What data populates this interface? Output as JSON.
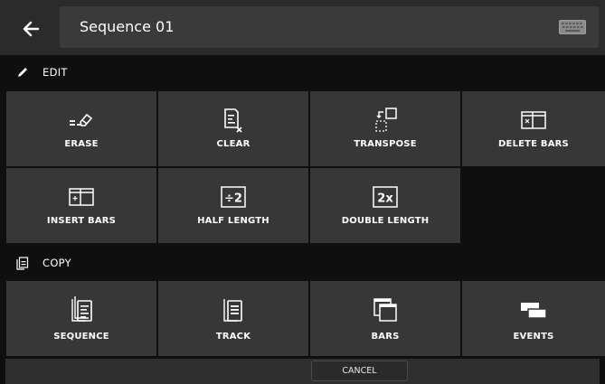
{
  "header": {
    "back_icon": "arrow-left-icon",
    "title": "Sequence 01",
    "keyboard_icon": "keyboard-icon"
  },
  "sections": {
    "edit": {
      "label": "EDIT",
      "icon": "pencil-icon"
    },
    "copy": {
      "label": "COPY",
      "icon": "copy-icon"
    }
  },
  "edit_buttons": [
    {
      "label": "ERASE",
      "icon": "eraser-icon"
    },
    {
      "label": "CLEAR",
      "icon": "clear-list-icon"
    },
    {
      "label": "TRANSPOSE",
      "icon": "transpose-icon"
    },
    {
      "label": "DELETE BARS",
      "icon": "delete-bars-icon"
    },
    {
      "label": "INSERT BARS",
      "icon": "insert-bars-icon"
    },
    {
      "label": "HALF LENGTH",
      "icon": "half-length-icon",
      "glyph": "÷2"
    },
    {
      "label": "DOUBLE LENGTH",
      "icon": "double-length-icon",
      "glyph": "2x"
    }
  ],
  "copy_buttons": [
    {
      "label": "SEQUENCE",
      "icon": "copy-sequence-icon"
    },
    {
      "label": "TRACK",
      "icon": "copy-track-icon"
    },
    {
      "label": "BARS",
      "icon": "copy-bars-icon"
    },
    {
      "label": "EVENTS",
      "icon": "copy-events-icon"
    }
  ],
  "footer": {
    "cancel_label": "CANCEL"
  },
  "colors": {
    "background": "#0f0f0f",
    "tile": "#373737",
    "topbar": "#2b2b2b",
    "text": "#ffffff"
  }
}
